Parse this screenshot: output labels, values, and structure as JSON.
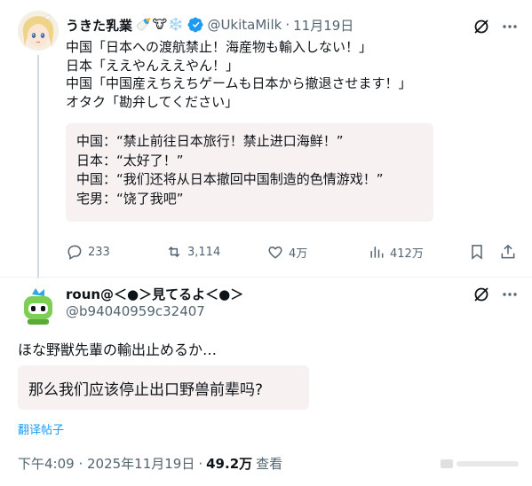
{
  "colors": {
    "text_primary": "#0f1419",
    "text_secondary": "#536471",
    "accent_blue": "#1d9bf0",
    "translation_bg": "#f7f1f2",
    "thread_line": "#cfd9de"
  },
  "tweet": {
    "display_name": "うきた乳業",
    "name_emojis": "🍼🐮❄️",
    "verified_icon": "verified-badge-icon",
    "handle": "@UkitaMilk",
    "separator": "·",
    "date": "11月19日",
    "text": "中国「日本への渡航禁止！海産物も輸入しない！」\n日本「ええやんええやん！」\n中国「中国産えちえちゲームも日本から撤退させます！」\nオタク「勘弁してください」",
    "translation": "中国：“禁止前往日本旅行！禁止进口海鲜！”\n日本：“太好了！”\n中国：“我们还将从日本撤回中国制造的色情游戏！”\n宅男：“饶了我吧”",
    "actions": {
      "replies": "233",
      "retweets": "3,114",
      "likes": "4万",
      "views": "412万"
    }
  },
  "reply": {
    "display_name": "roun@＜●＞見てるよ＜●＞",
    "handle": "@b94040959c32407",
    "text": "ほな野獣先輩の輸出止めるか…",
    "translation": "那么我们应该停止出口野兽前辈吗?",
    "translate_link": "翻译帖子",
    "timestamp": "下午4:09 · 2025年11月19日",
    "views_separator": "·",
    "views_count": "49.2万",
    "views_label": "查看"
  }
}
